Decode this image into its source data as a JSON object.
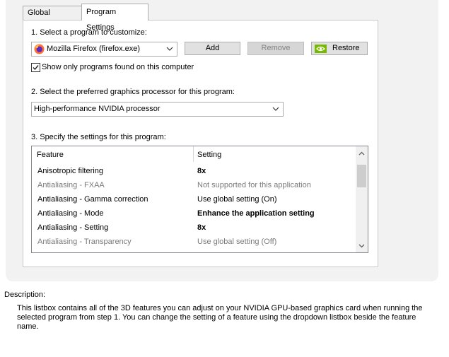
{
  "tabs": [
    {
      "label": "Global Settings"
    },
    {
      "label": "Program Settings"
    }
  ],
  "step1": {
    "label": "1. Select a program to customize:",
    "program_value": "Mozilla Firefox (firefox.exe)",
    "add_label": "Add",
    "remove_label": "Remove",
    "restore_label": "Restore",
    "checkbox_label": "Show only programs found on this computer",
    "checkbox_checked": true
  },
  "step2": {
    "label": "2. Select the preferred graphics processor for this program:",
    "gpu_value": "High-performance NVIDIA processor"
  },
  "step3": {
    "label": "3. Specify the settings for this program:",
    "columns": [
      "Feature",
      "Setting"
    ],
    "rows": [
      {
        "feature": "Anisotropic filtering",
        "setting": "8x"
      },
      {
        "feature": "Antialiasing - FXAA",
        "setting": "Not supported for this application"
      },
      {
        "feature": "Antialiasing - Gamma correction",
        "setting": "Use global setting (On)"
      },
      {
        "feature": "Antialiasing - Mode",
        "setting": "Enhance the application setting"
      },
      {
        "feature": "Antialiasing - Setting",
        "setting": "8x"
      },
      {
        "feature": "Antialiasing - Transparency",
        "setting": "Use global setting (Off)"
      }
    ]
  },
  "description": {
    "title": "Description:",
    "text": "This listbox contains all of the 3D features you can adjust on your NVIDIA GPU-based graphics card when running the selected program from step 1. You can change the setting of a feature using the dropdown listbox beside the feature name."
  },
  "colors": {
    "nvidia_green": "#76b900",
    "firefox_orange": "#ff7139"
  }
}
